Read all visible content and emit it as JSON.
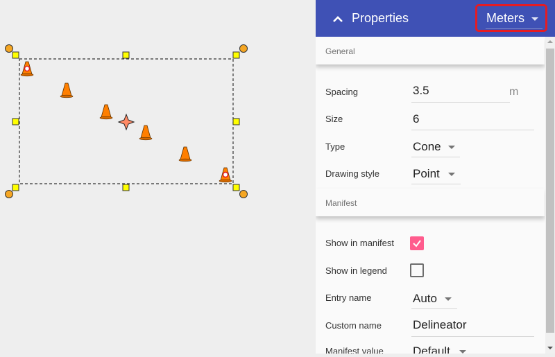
{
  "header": {
    "title": "Properties",
    "collapse_icon": "chevron-up-icon",
    "units_value": "Meters",
    "units_icon": "dropdown-arrow-icon",
    "accent_color": "#3f51b5",
    "highlight_color": "#e51c23"
  },
  "sections": {
    "general": "General",
    "manifest": "Manifest"
  },
  "general": {
    "spacing": {
      "label": "Spacing",
      "value": "3.5",
      "unit": "m"
    },
    "size": {
      "label": "Size",
      "value": "6"
    },
    "type": {
      "label": "Type",
      "value": "Cone"
    },
    "drawing_style": {
      "label": "Drawing style",
      "value": "Point"
    }
  },
  "manifest": {
    "show_in_manifest": {
      "label": "Show in manifest",
      "checked": true
    },
    "show_in_legend": {
      "label": "Show in legend",
      "checked": false
    },
    "entry_name": {
      "label": "Entry name",
      "value": "Auto"
    },
    "custom_name": {
      "label": "Custom name",
      "value": "Delineator"
    },
    "manifest_value": {
      "label": "Manifest value",
      "value": "Default"
    }
  },
  "canvas": {
    "object": "cone-line",
    "cone_count": 6,
    "cone_color": "#ff7f00",
    "handle_color": "#ffff00",
    "rotate_handle_color": "#f5a623"
  }
}
